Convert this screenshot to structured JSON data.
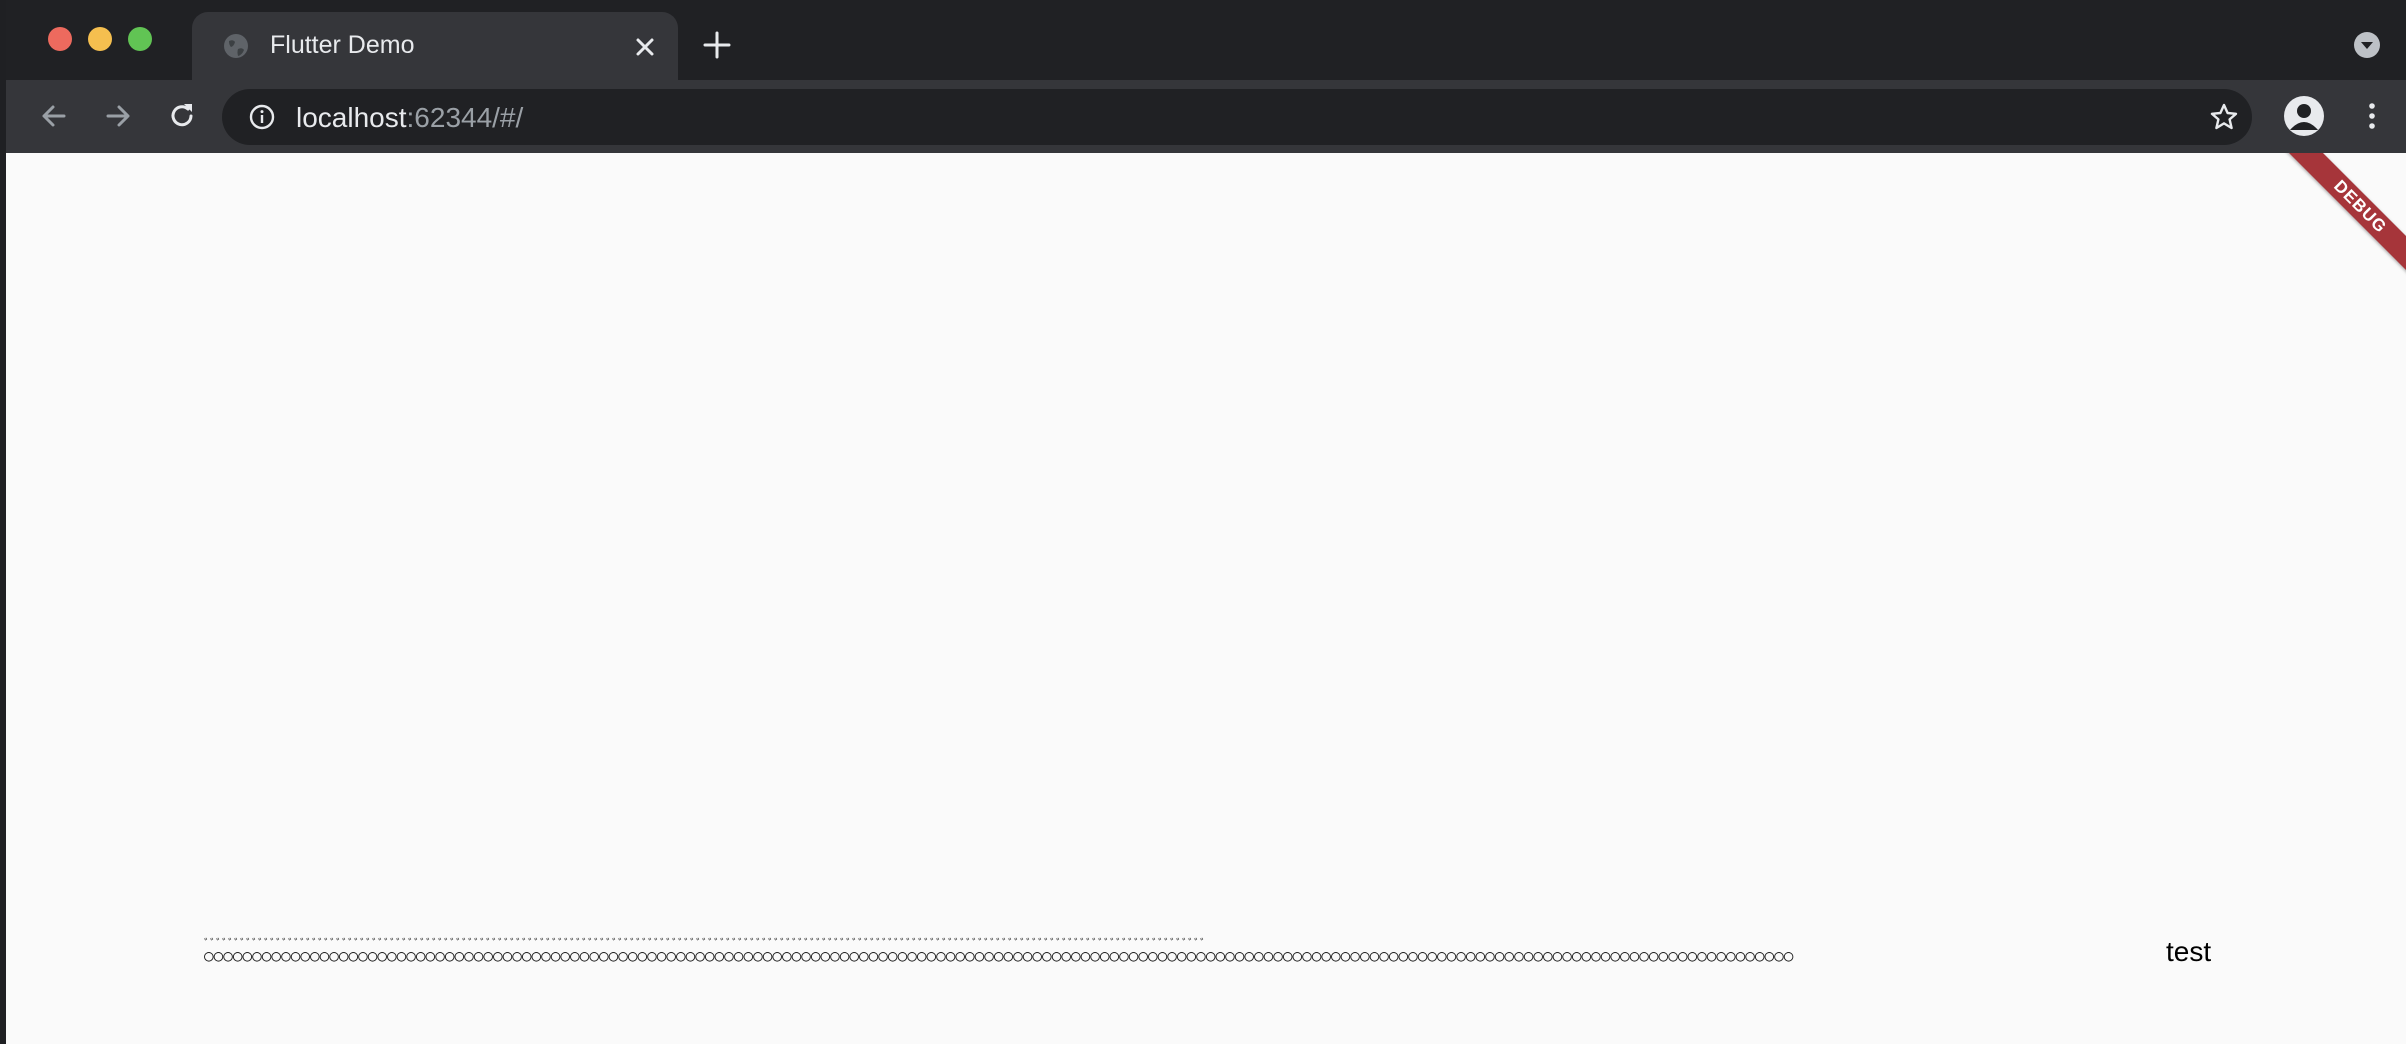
{
  "browser": {
    "tab": {
      "title": "Flutter Demo"
    },
    "url": {
      "host": "localhost",
      "rest": ":62344/#/"
    }
  },
  "content": {
    "debug_banner": "DEBUG",
    "garbled_top": "ﾞﾞﾞﾞﾞﾞﾞﾞﾞﾞﾞﾞﾞﾞﾞﾞﾞﾞﾞﾞﾞﾞﾞﾞﾞﾞﾞﾞﾞﾞﾞﾞﾞﾞﾞﾞﾞﾞﾞﾞﾞﾞﾞﾞﾞﾞﾞﾞﾞﾞﾞﾞﾞﾞﾞﾞﾞﾞﾞﾞﾞﾞﾞﾞﾞﾞﾞﾞﾞﾞﾞﾞﾞﾞﾞﾞﾞﾞﾞﾞﾞﾞﾞﾞﾞﾞﾞﾞﾞﾞﾞﾞﾞﾞﾞﾞﾞﾞﾞﾞﾞﾞﾞﾞﾞﾞﾞﾞﾞﾞﾞﾞﾞﾞﾞﾞﾞﾞﾞﾞﾞﾞﾞﾞﾞﾞﾞﾞﾞﾞﾞﾞﾞﾞﾞﾞﾞﾞﾞﾞﾞﾞﾞﾞﾞﾞﾞﾞﾞﾞﾞﾞﾞﾞﾞﾞﾞﾞﾞﾞﾞﾞﾞﾞﾞﾞﾞ",
    "garbled_bottom": "○○○○○○○○○○○○○○○○○○○○○○○○○○○○○○○○○○○○○○○○○○○○○○○○○○○○○○○○○○○○○○○○○○○○○○○○○○○○○○○○○○○○○○○○○○○○○○○○○○○○○○○○○○○○○○○○○○○○○○○○○○○○○○○○○○○○○○○○○○○○○○○○○○○○○○○○○○○○○○○○○○○○○",
    "test_text": "test"
  }
}
